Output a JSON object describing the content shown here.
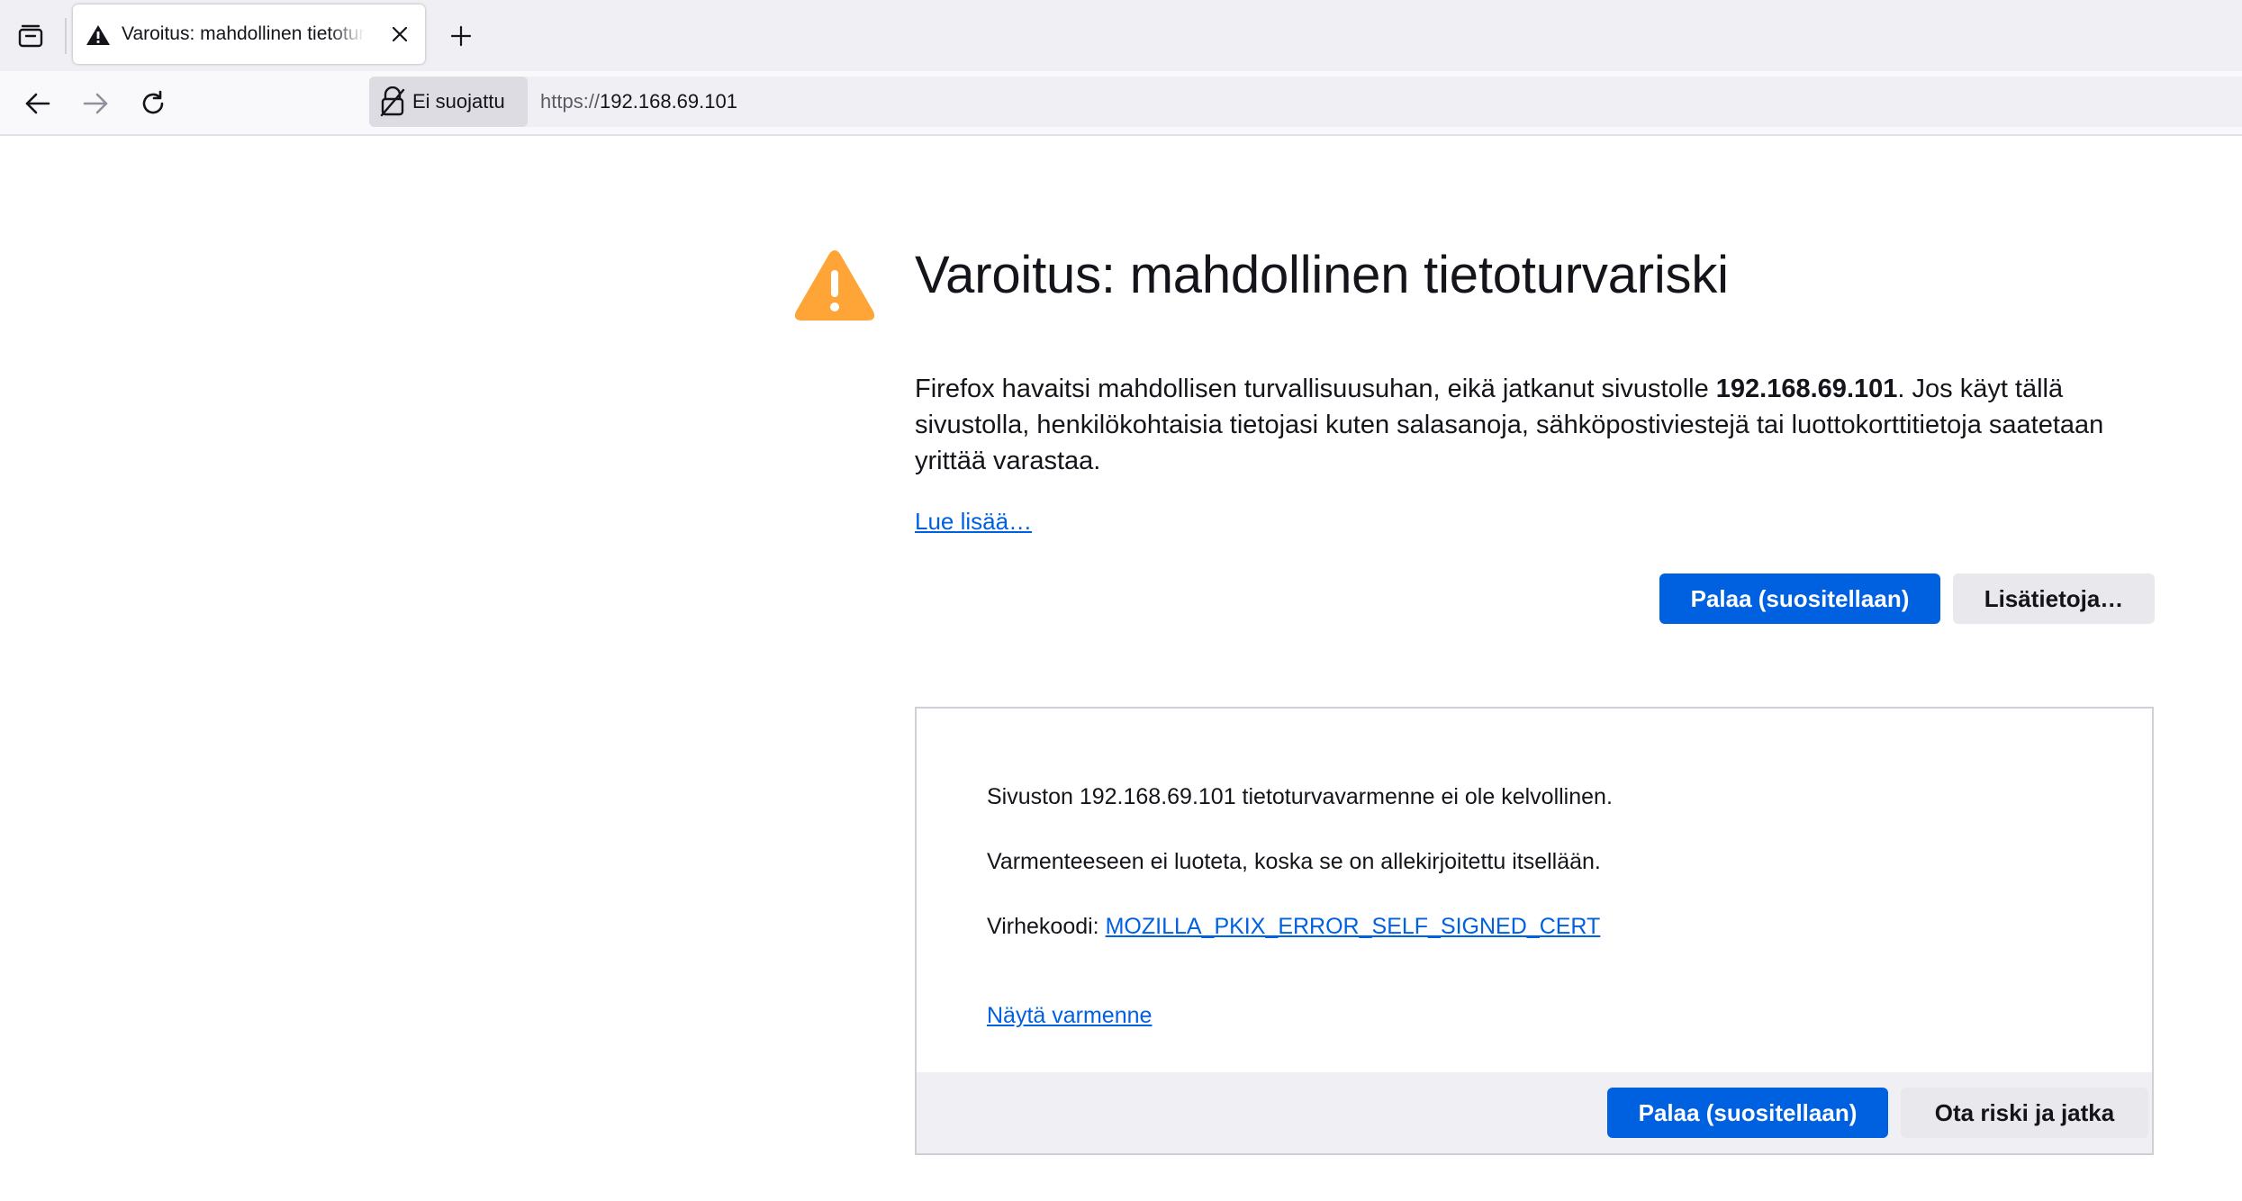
{
  "browser": {
    "tab": {
      "title": "Varoitus: mahdollinen tietoturvariski"
    },
    "urlbar": {
      "identity_label": "Ei suojattu",
      "url_scheme": "https://",
      "url_host": "192.168.69.101"
    }
  },
  "page": {
    "title": "Varoitus: mahdollinen tietoturvariski",
    "description_before": "Firefox havaitsi mahdollisen turvallisuusuhan, eikä jatkanut sivustolle ",
    "description_host": "192.168.69.101",
    "description_after": ". Jos käyt tällä sivustolla, henkilökohtaisia tietojasi kuten salasanoja, sähköpostiviestejä tai luottokorttitietoja saatetaan yrittää varastaa.",
    "learn_more": "Lue lisää…",
    "go_back_button": "Palaa (suositellaan)",
    "advanced_button": "Lisätietoja…"
  },
  "advanced": {
    "line1": "Sivuston 192.168.69.101 tietoturvavarmenne ei ole kelvollinen.",
    "line2": "Varmenteeseen ei luoteta, koska se on allekirjoitettu itsellään.",
    "error_code_label": "Virhekoodi: ",
    "error_code": "MOZILLA_PKIX_ERROR_SELF_SIGNED_CERT",
    "view_certificate": "Näytä varmenne",
    "go_back_button": "Palaa (suositellaan)",
    "accept_risk_button": "Ota riski ja jatka"
  },
  "colors": {
    "accent": "#0061e0",
    "warning": "#ffa436",
    "chrome_bg": "#f0f0f4"
  }
}
